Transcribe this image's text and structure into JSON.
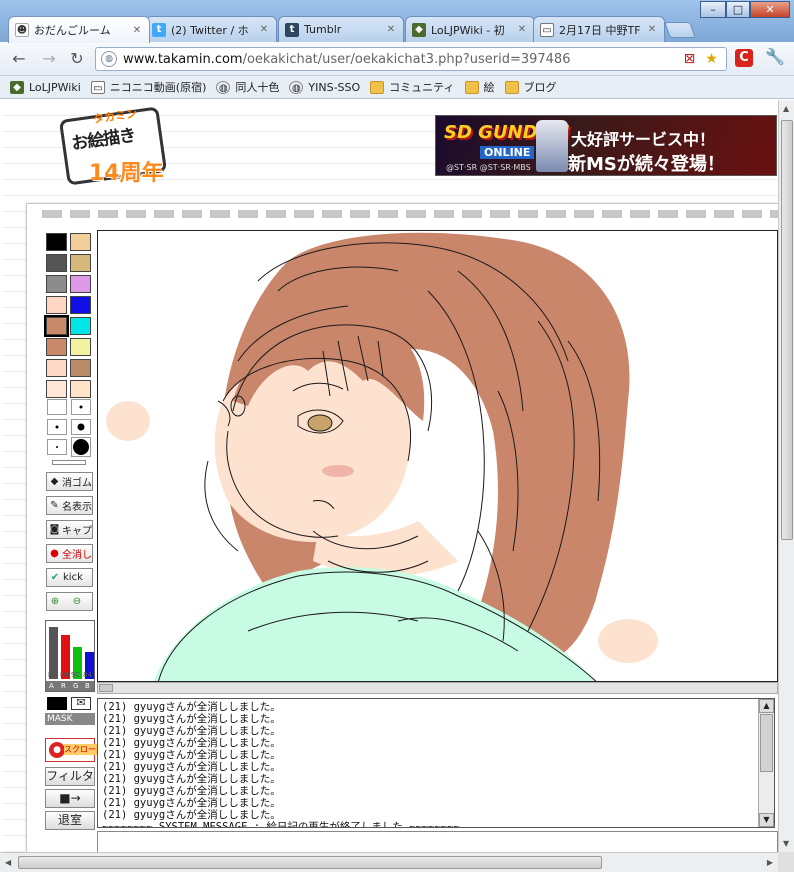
{
  "browser": {
    "tabs": [
      {
        "label": "おだんごルーム",
        "icon": "room-icon",
        "active": true
      },
      {
        "label": "(2) Twitter / ホ",
        "icon": "twitter-icon",
        "active": false
      },
      {
        "label": "Tumblr",
        "icon": "tumblr-icon",
        "active": false
      },
      {
        "label": "LoLJPWiki - 初",
        "icon": "wiki-icon",
        "active": false
      },
      {
        "label": "2月17日 中野TF",
        "icon": "tv-icon",
        "active": false
      }
    ],
    "url": "www.takamin.com/oekakichat/user/oekakichat3.php?userid=397486",
    "url_host": "www.takamin.com",
    "url_path": "/oekakichat/user/oekakichat3.php?userid=397486",
    "bookmarks": [
      {
        "label": "LoLJPWiki",
        "icon": "wiki-icon"
      },
      {
        "label": "ニコニコ動画(原宿)",
        "icon": "tv-icon"
      },
      {
        "label": "同人十色",
        "icon": "globe-icon"
      },
      {
        "label": "YINS-SSO",
        "icon": "globe-icon"
      },
      {
        "label": "コミュニティ",
        "icon": "folder-icon"
      },
      {
        "label": "絵",
        "icon": "folder-icon"
      },
      {
        "label": "ブログ",
        "icon": "folder-icon"
      }
    ],
    "extension_label": "C"
  },
  "site": {
    "logo_kana": "タカミン",
    "logo_main": "お絵描き",
    "logo_years": "14周年",
    "banner_brand": "SD GUNDAM",
    "banner_online": "ONLINE",
    "banner_sub": "@ST·SR @ST·SR·MBS",
    "banner_line1": "大好評サービス中！",
    "banner_line2": "新MSが続々登場！"
  },
  "palette": {
    "colors": [
      [
        "#000000",
        "#f2cf9a"
      ],
      [
        "#555555",
        "#d6b87a"
      ],
      [
        "#8c8c8c",
        "#dd99e6"
      ],
      [
        "#ffd6c2",
        "#1010e6"
      ],
      [
        "#c98a6a",
        "#00e6e6"
      ],
      [
        "#c98a6a",
        "#f2f2a2"
      ],
      [
        "#ffd9c6",
        "#b98a6a"
      ],
      [
        "#ffe6d6",
        "#ffe6c8"
      ]
    ],
    "selected_index": 8
  },
  "tools": {
    "eraser_label": "消ゴム",
    "name_display_label": "名表示",
    "capture_label": "キャプ",
    "clear_all_label": "全消し",
    "kick_label": "kick",
    "mask_label": "MASK",
    "scroll_label": "スクロール",
    "filter_label": "フィルタ",
    "arrow_label": "■→",
    "exit_label": "退室",
    "rgb_labels": [
      "FF",
      "D6",
      "9C",
      "84"
    ],
    "rgb_channel_labels": [
      "A",
      "R",
      "G",
      "B"
    ],
    "rgb_levels": [
      1.0,
      0.84,
      0.61,
      0.52
    ],
    "rgb_colors": [
      "#555555",
      "#e01010",
      "#10c010",
      "#1010d0"
    ]
  },
  "chat": {
    "messages": [
      "(21) gyuygさんが全消ししました。",
      "(21) gyuygさんが全消ししました。",
      "(21) gyuygさんが全消ししました。",
      "(21) gyuygさんが全消ししました。",
      "(21) gyuygさんが全消ししました。",
      "(21) gyuygさんが全消ししました。",
      "(21) gyuygさんが全消ししました。",
      "(21) gyuygさんが全消ししました。",
      "(21) gyuygさんが全消ししました。",
      "(21) gyuygさんが全消ししました。"
    ],
    "system_message": "~~~~~~~~ SYSTEM MESSAGE : 絵日記の再生が終了しました ~~~~~~~~",
    "input_value": ""
  },
  "artwork": {
    "hair_color": "#c9866a",
    "skin_color": "#fde2d0",
    "shirt_color": "#c8fbe3",
    "line_color": "#1a1a1a"
  }
}
